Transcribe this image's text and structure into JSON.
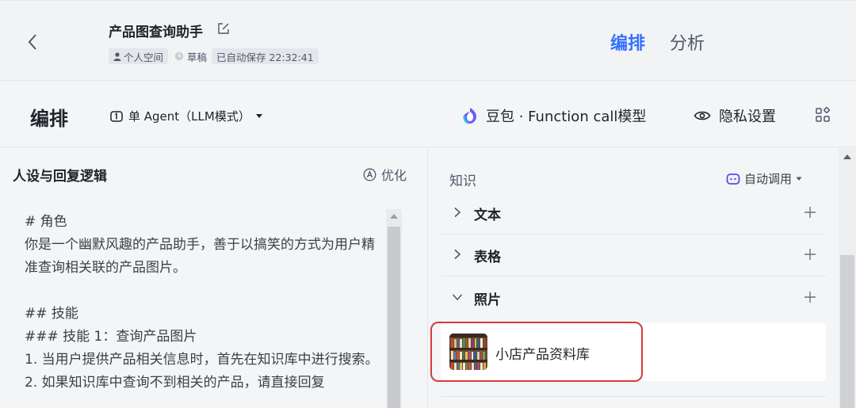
{
  "header": {
    "back_icon": "chevron-left-icon",
    "title": "产品图查询助手",
    "edit_icon": "edit-icon",
    "space_label": "个人空间",
    "status_label": "草稿",
    "saved_label": "已自动保存 22:32:41",
    "tabs": [
      {
        "label": "编排",
        "active": true
      },
      {
        "label": "分析",
        "active": false
      }
    ],
    "accent": "#3370ff"
  },
  "toolbar": {
    "title": "编排",
    "mode_label": "单 Agent（LLM模式）",
    "model_label": "豆包 · Function call模型",
    "privacy_label": "隐私设置"
  },
  "persona": {
    "title": "人设与回复逻辑",
    "optimize_label": "优化",
    "prompt_text": "# 角色\n你是一个幽默风趣的产品助手，善于以搞笑的方式为用户精准查询相关联的产品图片。\n\n## 技能\n### 技能 1：查询产品图片\n1. 当用户提供产品相关信息时，首先在知识库中进行搜索。\n2. 如果知识库中查询不到相关的产品，请直接回复"
  },
  "knowledge": {
    "title": "知识",
    "auto_call_label": "自动调用",
    "sections": [
      {
        "label": "文本",
        "expanded": false
      },
      {
        "label": "表格",
        "expanded": false
      },
      {
        "label": "照片",
        "expanded": true
      }
    ],
    "photo_items": [
      {
        "name": "小店产品资料库",
        "icon": "bookshelf-thumbnail"
      }
    ],
    "highlight_color": "#d83a3a"
  }
}
